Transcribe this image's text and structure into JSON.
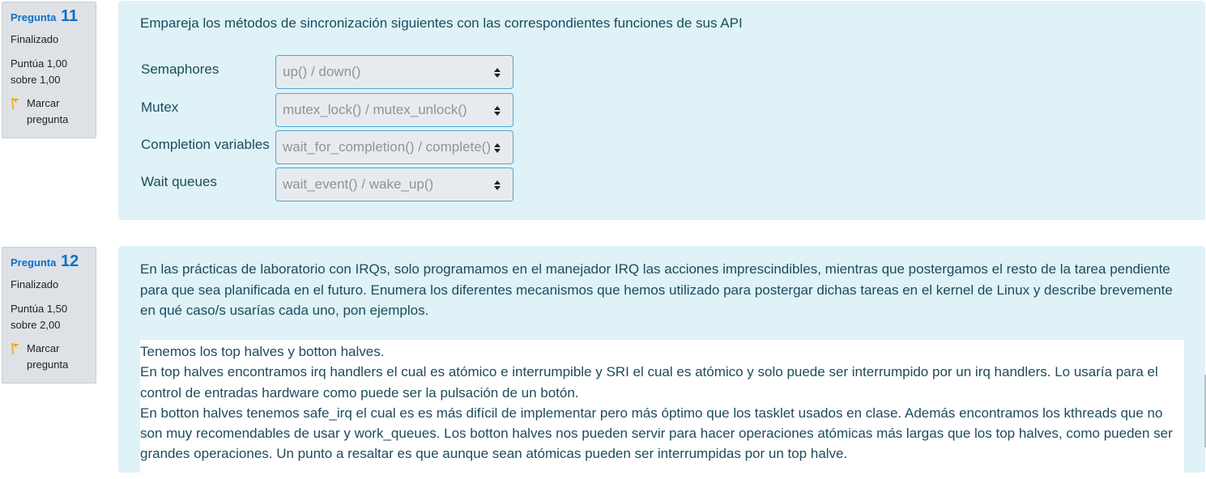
{
  "questions": [
    {
      "label": "Pregunta",
      "number": "11",
      "state": "Finalizado",
      "grade_line1": "Puntúa 1,00",
      "grade_line2": "sobre 1,00",
      "flag_line1": "Marcar",
      "flag_line2": "pregunta",
      "text": "Empareja los métodos de sincronización siguientes con las correspondientes funciones de sus API",
      "matches": [
        {
          "label": "Semaphores",
          "selected": "up() / down()"
        },
        {
          "label": "Mutex",
          "selected": "mutex_lock() / mutex_unlock()"
        },
        {
          "label": "Completion variables",
          "selected": "wait_for_completion() / complete()"
        },
        {
          "label": "Wait queues",
          "selected": "wait_event() / wake_up()"
        }
      ]
    },
    {
      "label": "Pregunta",
      "number": "12",
      "state": "Finalizado",
      "grade_line1": "Puntúa 1,50",
      "grade_line2": "sobre 2,00",
      "flag_line1": "Marcar",
      "flag_line2": "pregunta",
      "text": "En las prácticas de laboratorio con IRQs, solo programamos en el manejador IRQ las acciones imprescindibles, mientras que postergamos el resto de la tarea pendiente para que sea planificada en el futuro. Enumera los diferentes mecanismos que hemos utilizado para postergar dichas tareas en el kernel de Linux y describe brevemente en qué caso/s usarías cada uno, pon ejemplos.",
      "answer": [
        "Tenemos los top halves y botton halves.",
        "En top halves encontramos irq handlers el cual es atómico e interrumpible y SRI el cual es atómico y solo puede ser interrumpido por un irq handlers. Lo usaría para el control de entradas hardware como puede ser la pulsación de un botón.",
        "En botton halves tenemos safe_irq el cual es es más difícil de implementar pero más óptimo que los tasklet usados en clase. Además encontramos los kthreads que no son muy recomendables de usar y work_queues. Los botton halves nos pueden servir para hacer operaciones atómicas más largas que los top halves, como pueden ser grandes operaciones. Un punto a resaltar es que aunque sean atómicas pueden ser interrumpidas por un top halve."
      ]
    }
  ],
  "colors": {
    "flag": "#f0a30a",
    "question_number": "#0f6fc5",
    "content_bg": "#def2f8",
    "info_bg": "#dee2e6"
  },
  "icons": {
    "flag": "flag-icon",
    "select_caret": "updown-caret-icon"
  }
}
